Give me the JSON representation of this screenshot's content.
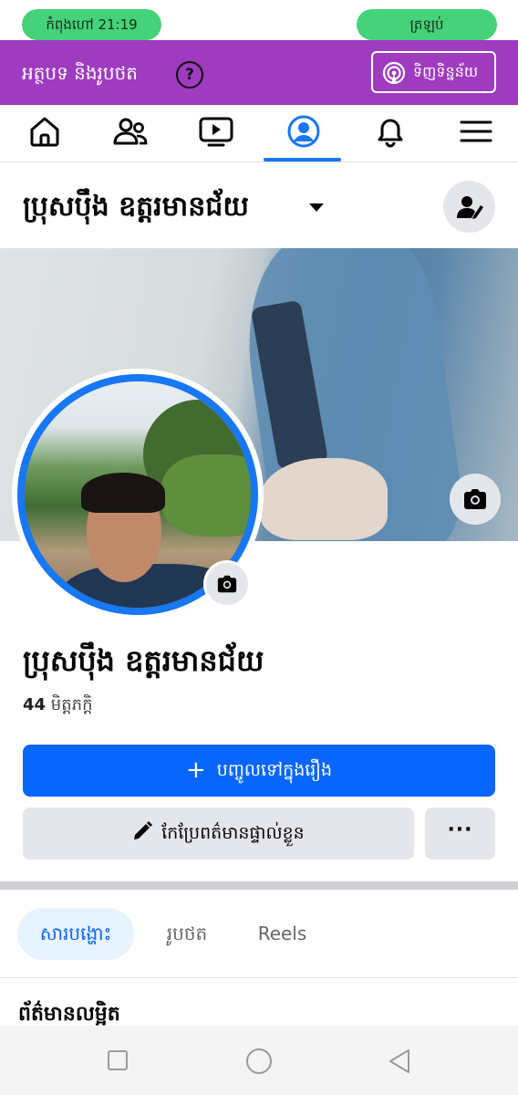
{
  "status_bar": {
    "left_pill": "កំពុងហៅ   21:19",
    "right_pill": "ត្រឡប់"
  },
  "promo_bar": {
    "text": "អត្ថបទ និងរូបថត",
    "help_glyph": "?",
    "buy_data_label": "ទិញទិន្នន័យ",
    "color": "#9f3bbf"
  },
  "nav": {
    "tabs": [
      {
        "icon": "home-icon"
      },
      {
        "icon": "friends-icon"
      },
      {
        "icon": "video-icon"
      },
      {
        "icon": "profile-icon",
        "active": true
      },
      {
        "icon": "bell-icon"
      },
      {
        "icon": "menu-icon"
      }
    ],
    "active_color": "#1877f2"
  },
  "header": {
    "name": "ប្រុសប៉ឹង ឧត្តរមានជ័យ"
  },
  "profile": {
    "name": "ប្រុសប៉ឹង ឧត្តរមានជ័យ",
    "friends_count": "44",
    "friends_label": "មិត្តភក្តិ"
  },
  "actions": {
    "add_story_label": "បញ្ចូលទៅក្នុងរឿង",
    "plus_glyph": "+",
    "edit_profile_label": "កែប្រែពត៌មានផ្ទាល់ខ្លួន",
    "more_label": "···",
    "primary_color": "#0866ff"
  },
  "subtabs": {
    "posts": "សារបង្ហោះ",
    "photos": "រូបថត",
    "reels": "Reels"
  },
  "details": {
    "title": "ព័ត៌មានលម្អិត"
  }
}
